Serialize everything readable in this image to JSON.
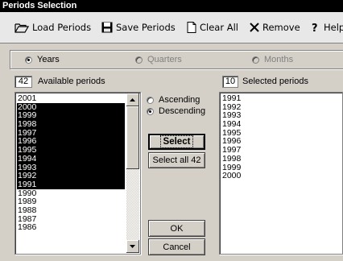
{
  "window": {
    "title": "Periods Selection"
  },
  "toolbar": {
    "load": "Load Periods",
    "save": "Save Periods",
    "clear": "Clear All",
    "remove": "Remove",
    "help": "Help"
  },
  "period_type": {
    "options": [
      {
        "label": "Years",
        "selected": true,
        "enabled": true
      },
      {
        "label": "Quarters",
        "selected": false,
        "enabled": false
      },
      {
        "label": "Months",
        "selected": false,
        "enabled": false
      }
    ]
  },
  "available": {
    "count": "42",
    "label": "Available periods",
    "items": [
      "2001",
      "2000",
      "1999",
      "1998",
      "1997",
      "1996",
      "1995",
      "1994",
      "1993",
      "1992",
      "1991",
      "1990",
      "1989",
      "1988",
      "1987",
      "1986"
    ],
    "selected": [
      "2000",
      "1999",
      "1998",
      "1997",
      "1996",
      "1995",
      "1994",
      "1993",
      "1992",
      "1991"
    ]
  },
  "sort": {
    "ascending": "Ascending",
    "descending": "Descending",
    "value": "descending"
  },
  "buttons": {
    "select": "Select",
    "select_all": "Select all 42",
    "ok": "OK",
    "cancel": "Cancel"
  },
  "selected": {
    "count": "10",
    "label": "Selected periods",
    "items": [
      "1991",
      "1992",
      "1993",
      "1994",
      "1995",
      "1996",
      "1997",
      "1998",
      "1999",
      "2000"
    ]
  }
}
